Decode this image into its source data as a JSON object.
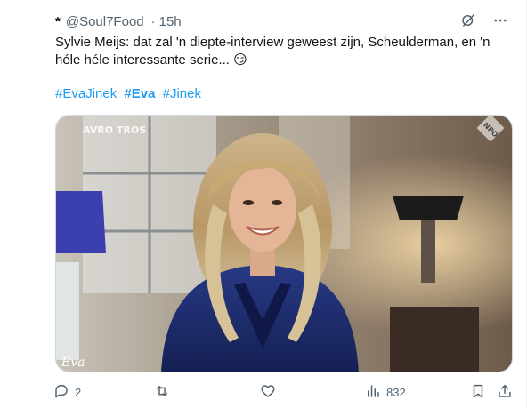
{
  "tweet": {
    "author_name": "*",
    "handle": "@Soul7Food",
    "separator": "·",
    "time": "15h",
    "text": "Sylvie Meijs: dat zal 'n diepte-interview geweest zijn, Scheulderman, en 'n héle héle interessante serie... 😏",
    "hashtags": [
      {
        "label": "#EvaJinek",
        "bold": false
      },
      {
        "label": "#Eva",
        "bold": true
      },
      {
        "label": "#Jinek",
        "bold": false
      }
    ],
    "media": {
      "logo_left": "AVRO TROS",
      "logo_right": "NPO",
      "corner_mark": "Eva"
    }
  },
  "actions": {
    "reply_count": "2",
    "retweet_count": "",
    "like_count": "",
    "views_count": "832"
  },
  "icons": {
    "grok": "grok-icon",
    "more": "more-icon",
    "reply": "reply-icon",
    "retweet": "retweet-icon",
    "like": "heart-icon",
    "views": "views-icon",
    "bookmark": "bookmark-icon",
    "share": "share-icon"
  },
  "colors": {
    "accent": "#1d9bf0",
    "secondary_text": "#536471",
    "primary_text": "#0f1419"
  }
}
